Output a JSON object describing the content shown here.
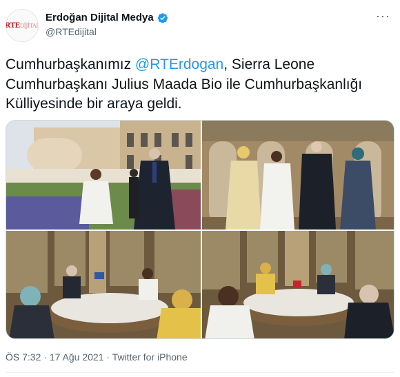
{
  "account": {
    "display_name": "Erdoğan Dijital Medya",
    "handle": "@RTEdijital",
    "avatar_text_bold": "RTE",
    "avatar_text_thin": "DİJİTAL",
    "verified_color": "#1d9bf0"
  },
  "tweet": {
    "text_before": "Cumhurbaşkanımız ",
    "mention": "@RTErdogan",
    "text_after": ", Sierra Leone Cumhurbaşkanı Julius Maada Bio ile Cumhurbaşkanlığı Külliyesinde bir araya geldi."
  },
  "meta": {
    "time": "ÖS 7:32",
    "separator": " · ",
    "date": "17 Ağu 2021",
    "source": "Twitter for iPhone"
  },
  "icons": {
    "more": "more-icon",
    "verified": "verified-badge-icon"
  },
  "colors": {
    "link": "#1d9bf0",
    "secondary_text": "#536471",
    "primary_text": "#0f1419"
  }
}
